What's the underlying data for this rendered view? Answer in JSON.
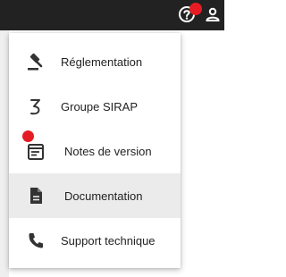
{
  "topbar": {
    "help_icon": "help-circle-icon",
    "user_icon": "user-icon",
    "notification": "red-dot"
  },
  "menu": {
    "items": [
      {
        "label": "Réglementation",
        "icon": "gavel-icon"
      },
      {
        "label": "Groupe SIRAP",
        "icon": "sirap-logo-icon"
      },
      {
        "label": "Notes de version",
        "icon": "release-notes-icon",
        "badge": "red-dot"
      },
      {
        "label": "Documentation",
        "icon": "document-icon",
        "active": true
      },
      {
        "label": "Support technique",
        "icon": "phone-icon"
      }
    ]
  },
  "colors": {
    "topbar_bg": "#222222",
    "badge": "#e51c23",
    "active_bg": "#ebebeb",
    "text": "#222222"
  }
}
